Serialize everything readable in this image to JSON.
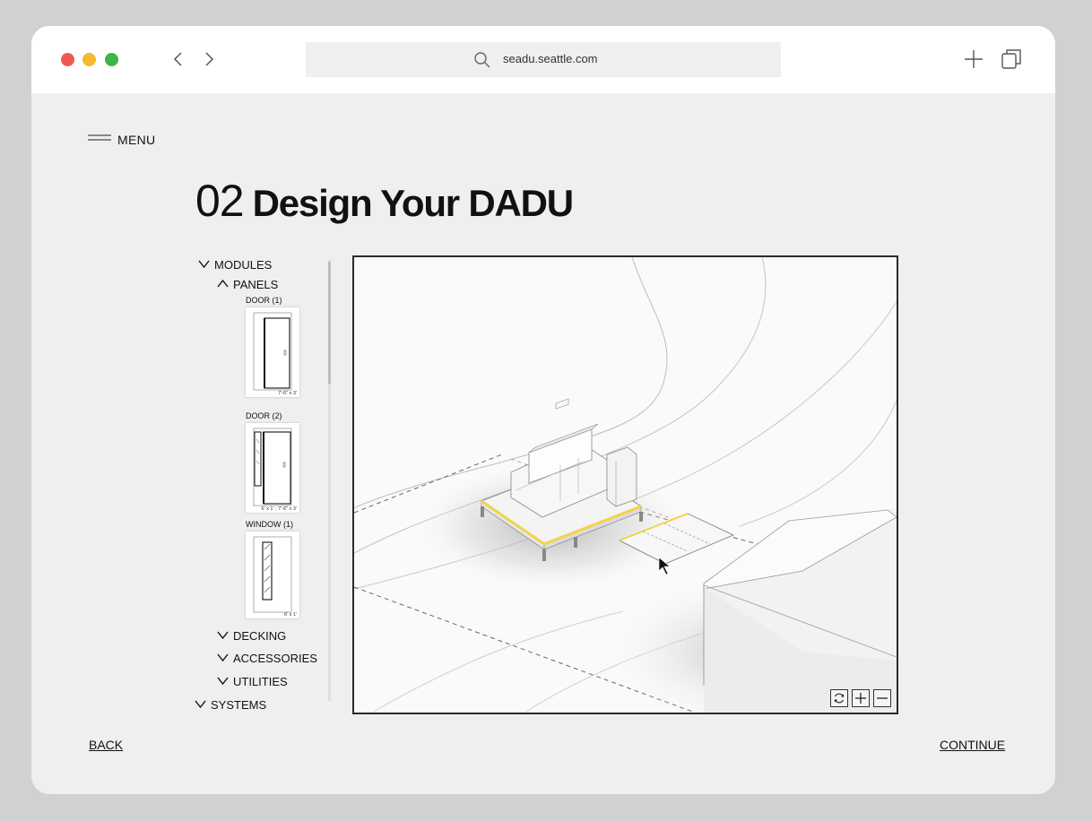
{
  "browser": {
    "url": "seadu.seattle.com"
  },
  "menu": {
    "label": "MENU"
  },
  "page": {
    "step_number": "02",
    "title": "Design Your DADU"
  },
  "sidebar": {
    "modules": "MODULES",
    "panels": "PANELS",
    "thumbnails": [
      {
        "label": "DOOR (1)",
        "dimension": "7'-6\" x 3'"
      },
      {
        "label": "DOOR (2)",
        "dimension": "6' x 1' ; 7'-6\" x 3'"
      },
      {
        "label": "WINDOW (1)",
        "dimension": "6' x 1'"
      }
    ],
    "decking": "DECKING",
    "accessories": "ACCESSORIES",
    "utilities": "UTILITIES",
    "systems": "SYSTEMS"
  },
  "viewer": {
    "controls": [
      "rotate-icon",
      "zoom-in-icon",
      "zoom-out-icon"
    ],
    "highlight_color": "#f3d34a"
  },
  "footer": {
    "back_label": "BACK",
    "continue_label": "CONTINUE"
  }
}
